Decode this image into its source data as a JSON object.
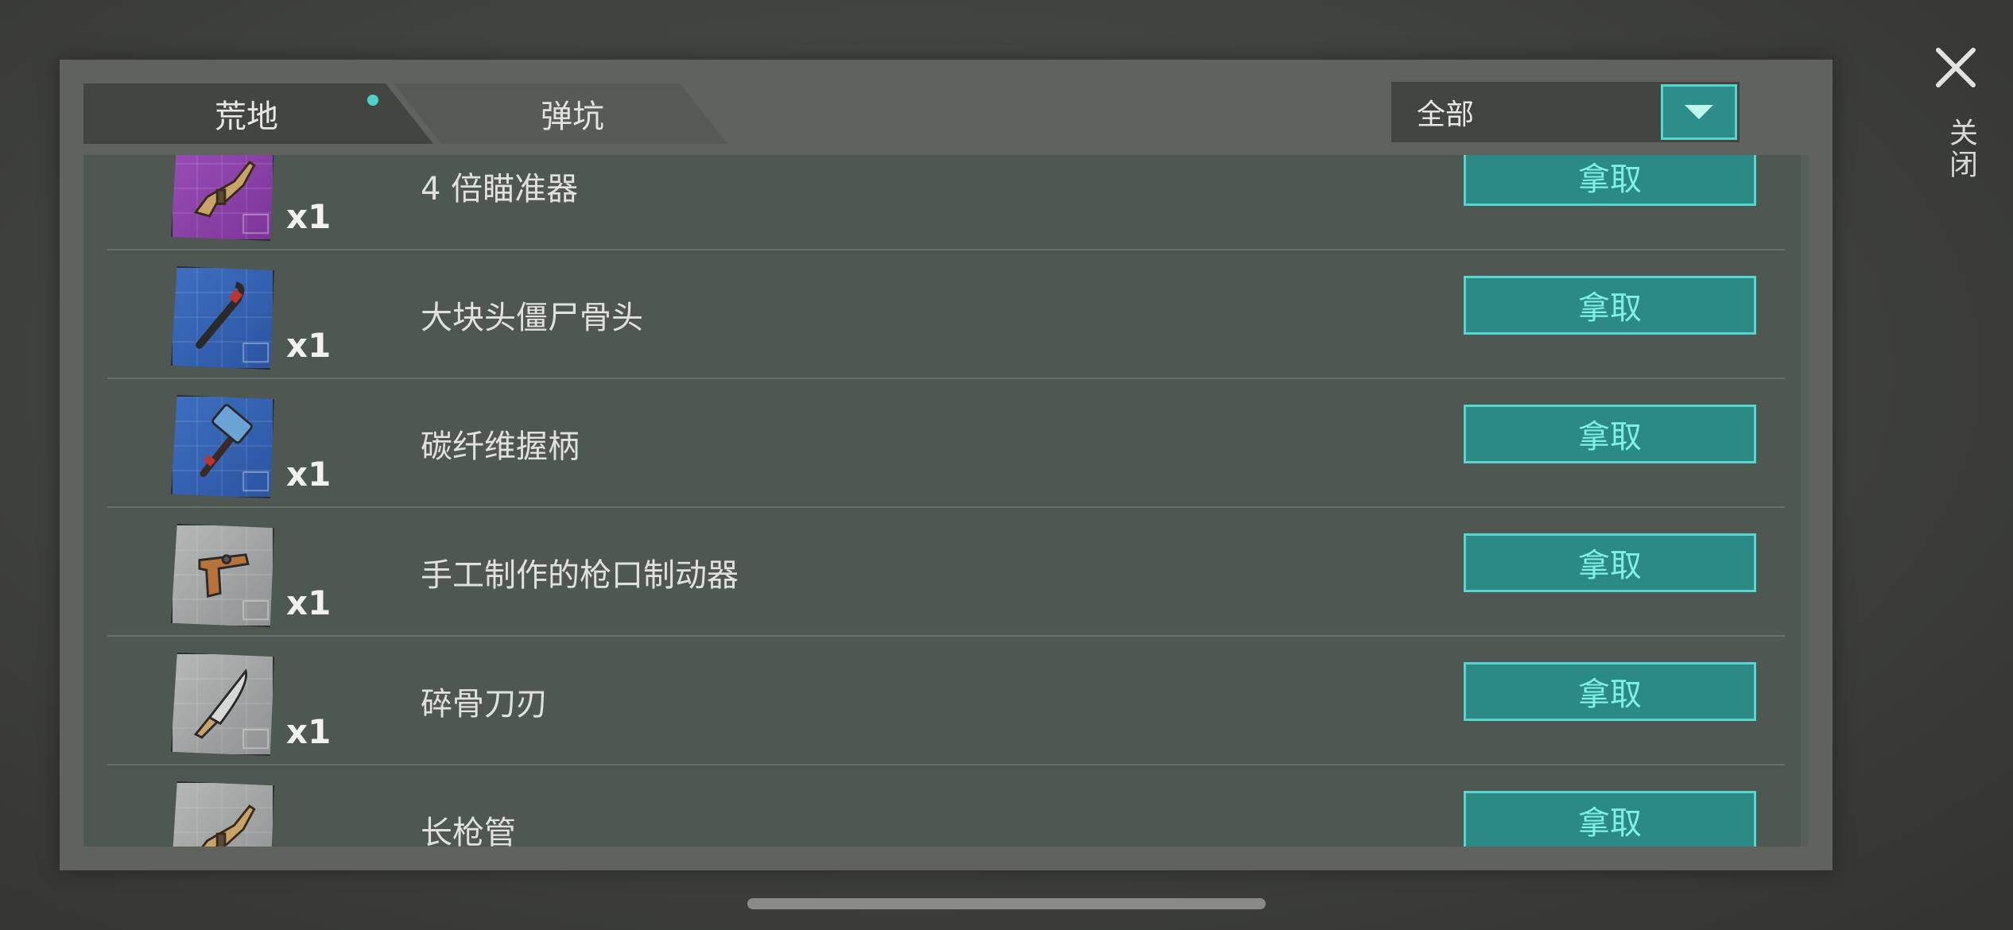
{
  "tabs": [
    {
      "label": "荒地",
      "active": true,
      "has_dot": true
    },
    {
      "label": "弹坑",
      "active": false
    }
  ],
  "filter": {
    "selected": "全部"
  },
  "items": [
    {
      "name": "4 倍瞄准器",
      "qty": "x1",
      "icon": "rifle-blueprint-icon",
      "rarity": "purple",
      "action": "拿取"
    },
    {
      "name": "大块头僵尸骨头",
      "qty": "x1",
      "icon": "crowbar-blueprint-icon",
      "rarity": "blue",
      "action": "拿取"
    },
    {
      "name": "碳纤维握柄",
      "qty": "x1",
      "icon": "hammer-blueprint-icon",
      "rarity": "blue",
      "action": "拿取"
    },
    {
      "name": "手工制作的枪口制动器",
      "qty": "x1",
      "icon": "pistol-blueprint-icon",
      "rarity": "grey",
      "action": "拿取"
    },
    {
      "name": "碎骨刀刃",
      "qty": "x1",
      "icon": "machete-blueprint-icon",
      "rarity": "grey",
      "action": "拿取"
    },
    {
      "name": "长枪管",
      "qty": "",
      "icon": "rifle-blueprint-icon",
      "rarity": "grey",
      "action": "拿取"
    }
  ],
  "close": {
    "label": "关闭"
  },
  "colors": {
    "accent": "#56d6cf",
    "button_bg": "#2b8a86",
    "panel": "#5f625d",
    "list_bg": "#4e5752"
  }
}
